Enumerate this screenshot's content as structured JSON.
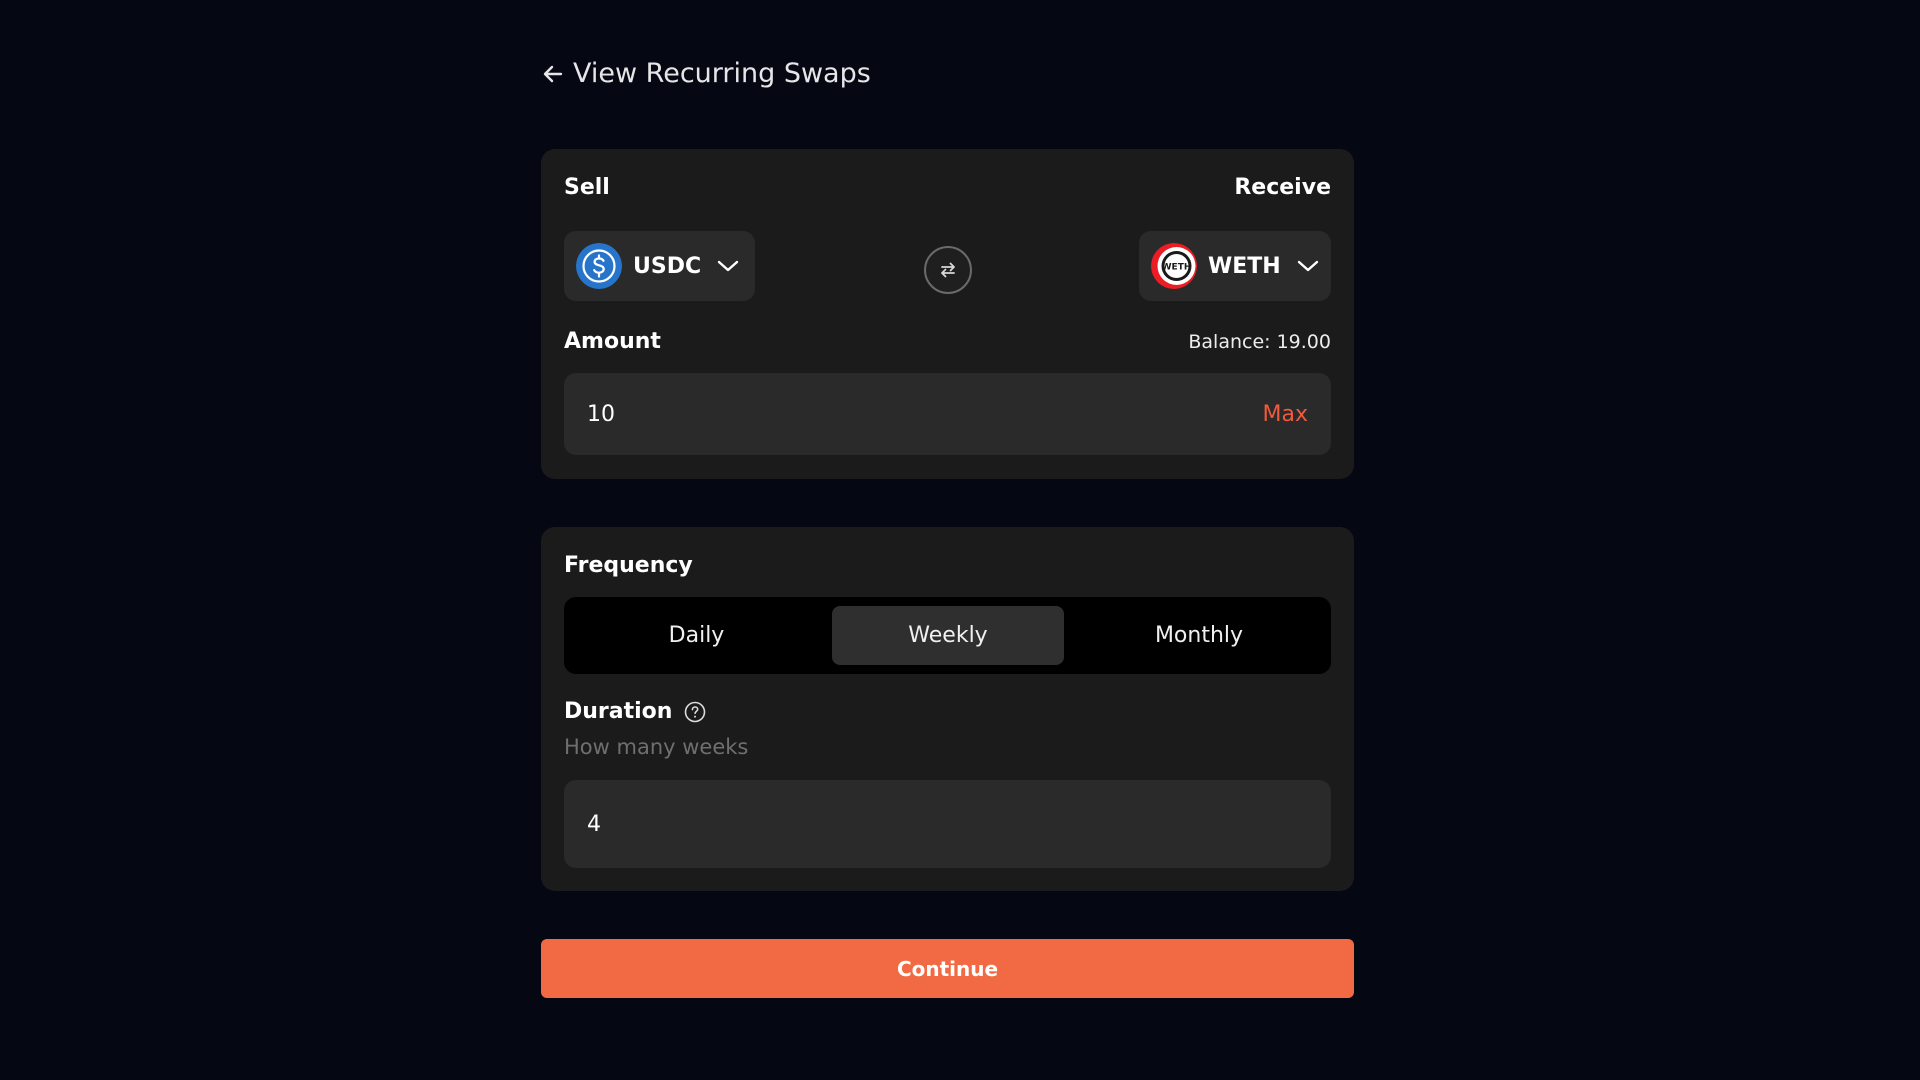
{
  "header": {
    "back_label": "View Recurring Swaps"
  },
  "swap": {
    "sell_label": "Sell",
    "receive_label": "Receive",
    "sell_token": {
      "symbol": "USDC",
      "icon": "usdc-icon",
      "color": "#2775CA"
    },
    "receive_token": {
      "symbol": "WETH",
      "icon": "weth-icon",
      "color": "#EC1C24"
    },
    "amount_label": "Amount",
    "balance_text": "Balance: 19.00",
    "amount_value": "10",
    "max_label": "Max"
  },
  "frequency": {
    "label": "Frequency",
    "options": [
      "Daily",
      "Weekly",
      "Monthly"
    ],
    "selected": "Weekly"
  },
  "duration": {
    "label": "Duration",
    "hint": "How many weeks",
    "value": "4"
  },
  "actions": {
    "continue_label": "Continue"
  },
  "colors": {
    "accent": "#F26A43",
    "max_text": "#EF5A3D",
    "background": "#050812",
    "card": "#1B1B1B"
  }
}
